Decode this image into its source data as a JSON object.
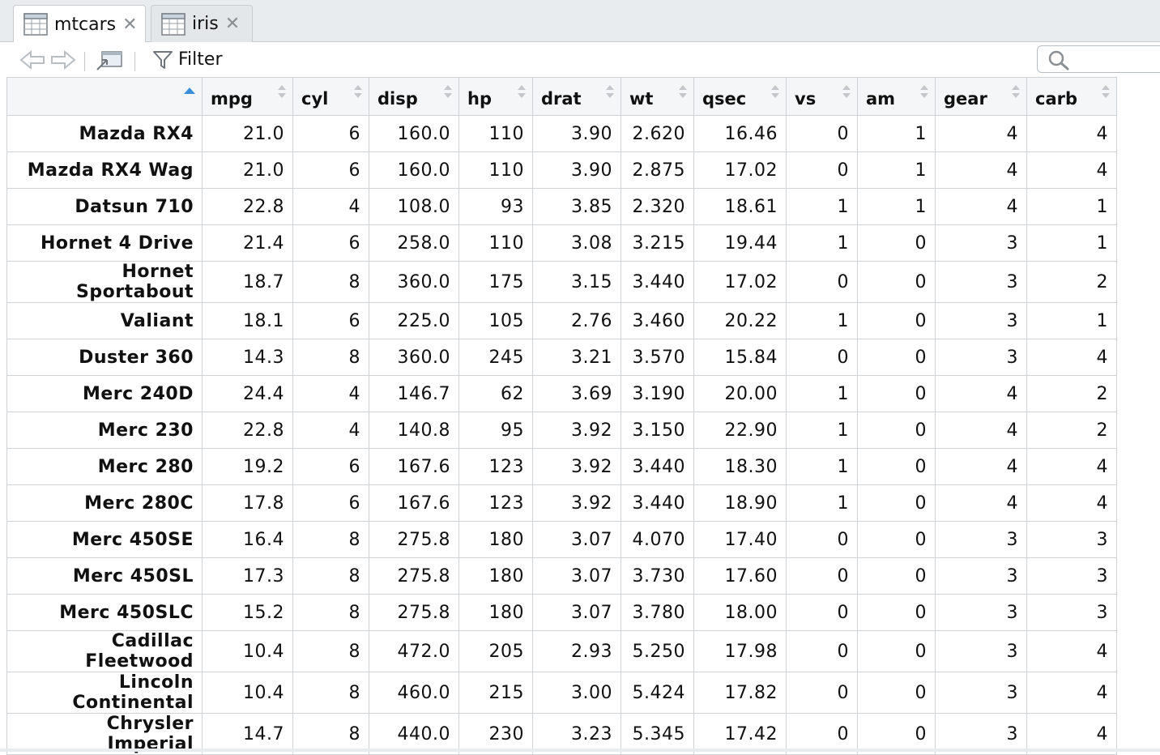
{
  "tabs": [
    {
      "label": "mtcars",
      "active": true
    },
    {
      "label": "iris",
      "active": false
    }
  ],
  "toolbar": {
    "filter_label": "Filter",
    "search_placeholder": ""
  },
  "colors": {
    "sort_active": "#3b8fd9",
    "grid_border": "#cfd3d6",
    "header_bg": "#f5f6f7"
  },
  "table": {
    "columns": [
      "mpg",
      "cyl",
      "disp",
      "hp",
      "drat",
      "wt",
      "qsec",
      "vs",
      "am",
      "gear",
      "carb"
    ],
    "rows": [
      {
        "name": "Mazda RX4",
        "values": [
          "21.0",
          "6",
          "160.0",
          "110",
          "3.90",
          "2.620",
          "16.46",
          "0",
          "1",
          "4",
          "4"
        ]
      },
      {
        "name": "Mazda RX4 Wag",
        "values": [
          "21.0",
          "6",
          "160.0",
          "110",
          "3.90",
          "2.875",
          "17.02",
          "0",
          "1",
          "4",
          "4"
        ]
      },
      {
        "name": "Datsun 710",
        "values": [
          "22.8",
          "4",
          "108.0",
          "93",
          "3.85",
          "2.320",
          "18.61",
          "1",
          "1",
          "4",
          "1"
        ]
      },
      {
        "name": "Hornet 4 Drive",
        "values": [
          "21.4",
          "6",
          "258.0",
          "110",
          "3.08",
          "3.215",
          "19.44",
          "1",
          "0",
          "3",
          "1"
        ]
      },
      {
        "name": "Hornet Sportabout",
        "values": [
          "18.7",
          "8",
          "360.0",
          "175",
          "3.15",
          "3.440",
          "17.02",
          "0",
          "0",
          "3",
          "2"
        ]
      },
      {
        "name": "Valiant",
        "values": [
          "18.1",
          "6",
          "225.0",
          "105",
          "2.76",
          "3.460",
          "20.22",
          "1",
          "0",
          "3",
          "1"
        ]
      },
      {
        "name": "Duster 360",
        "values": [
          "14.3",
          "8",
          "360.0",
          "245",
          "3.21",
          "3.570",
          "15.84",
          "0",
          "0",
          "3",
          "4"
        ]
      },
      {
        "name": "Merc 240D",
        "values": [
          "24.4",
          "4",
          "146.7",
          "62",
          "3.69",
          "3.190",
          "20.00",
          "1",
          "0",
          "4",
          "2"
        ]
      },
      {
        "name": "Merc 230",
        "values": [
          "22.8",
          "4",
          "140.8",
          "95",
          "3.92",
          "3.150",
          "22.90",
          "1",
          "0",
          "4",
          "2"
        ]
      },
      {
        "name": "Merc 280",
        "values": [
          "19.2",
          "6",
          "167.6",
          "123",
          "3.92",
          "3.440",
          "18.30",
          "1",
          "0",
          "4",
          "4"
        ]
      },
      {
        "name": "Merc 280C",
        "values": [
          "17.8",
          "6",
          "167.6",
          "123",
          "3.92",
          "3.440",
          "18.90",
          "1",
          "0",
          "4",
          "4"
        ]
      },
      {
        "name": "Merc 450SE",
        "values": [
          "16.4",
          "8",
          "275.8",
          "180",
          "3.07",
          "4.070",
          "17.40",
          "0",
          "0",
          "3",
          "3"
        ]
      },
      {
        "name": "Merc 450SL",
        "values": [
          "17.3",
          "8",
          "275.8",
          "180",
          "3.07",
          "3.730",
          "17.60",
          "0",
          "0",
          "3",
          "3"
        ]
      },
      {
        "name": "Merc 450SLC",
        "values": [
          "15.2",
          "8",
          "275.8",
          "180",
          "3.07",
          "3.780",
          "18.00",
          "0",
          "0",
          "3",
          "3"
        ]
      },
      {
        "name": "Cadillac Fleetwood",
        "values": [
          "10.4",
          "8",
          "472.0",
          "205",
          "2.93",
          "5.250",
          "17.98",
          "0",
          "0",
          "3",
          "4"
        ]
      },
      {
        "name": "Lincoln Continental",
        "values": [
          "10.4",
          "8",
          "460.0",
          "215",
          "3.00",
          "5.424",
          "17.82",
          "0",
          "0",
          "3",
          "4"
        ]
      },
      {
        "name": "Chrysler Imperial",
        "values": [
          "14.7",
          "8",
          "440.0",
          "230",
          "3.23",
          "5.345",
          "17.42",
          "0",
          "0",
          "3",
          "4"
        ]
      }
    ]
  }
}
